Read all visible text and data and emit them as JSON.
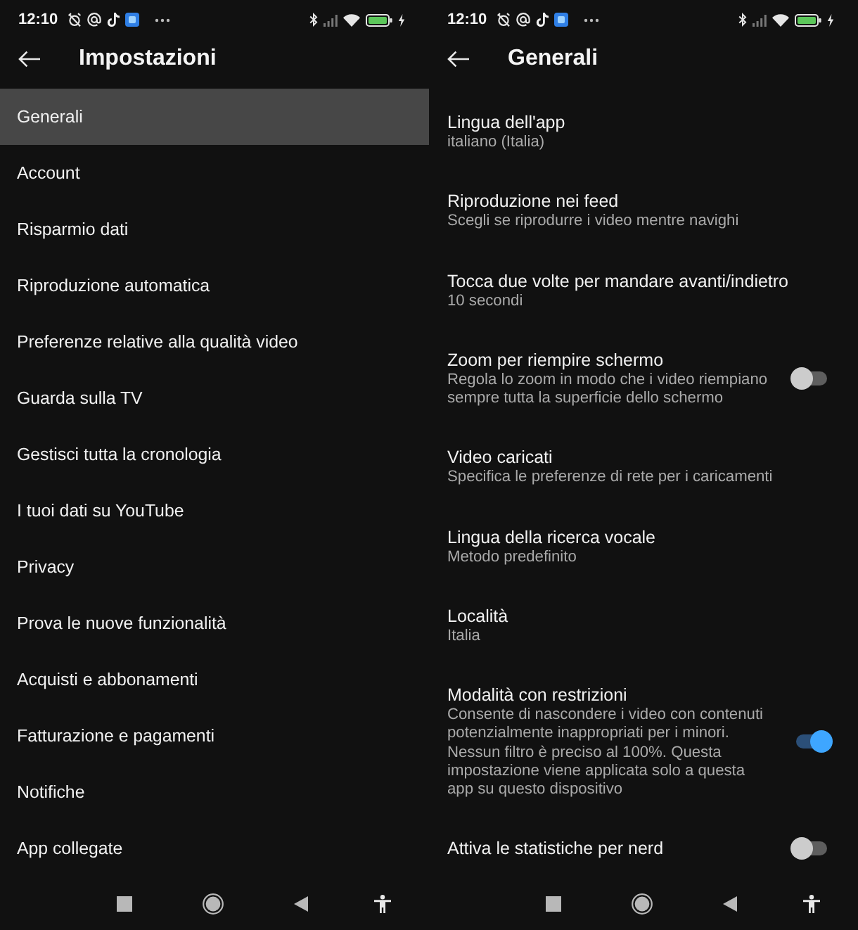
{
  "settings_screen": {
    "status_bar": {
      "time": "12:10"
    },
    "header": {
      "title": "Impostazioni"
    },
    "menu": [
      {
        "label": "Generali",
        "selected": true
      },
      {
        "label": "Account",
        "selected": false
      },
      {
        "label": "Risparmio dati",
        "selected": false
      },
      {
        "label": "Riproduzione automatica",
        "selected": false
      },
      {
        "label": "Preferenze relative alla qualità video",
        "selected": false
      },
      {
        "label": "Guarda sulla TV",
        "selected": false
      },
      {
        "label": "Gestisci tutta la cronologia",
        "selected": false
      },
      {
        "label": "I tuoi dati su YouTube",
        "selected": false
      },
      {
        "label": "Privacy",
        "selected": false
      },
      {
        "label": "Prova le nuove funzionalità",
        "selected": false
      },
      {
        "label": "Acquisti e abbonamenti",
        "selected": false
      },
      {
        "label": "Fatturazione e pagamenti",
        "selected": false
      },
      {
        "label": "Notifiche",
        "selected": false
      },
      {
        "label": "App collegate",
        "selected": false
      }
    ]
  },
  "general_screen": {
    "status_bar": {
      "time": "12:10"
    },
    "header": {
      "title": "Generali"
    },
    "settings": [
      {
        "kind": "option",
        "title": "Lingua dell'app",
        "subtitle": "italiano (Italia)"
      },
      {
        "kind": "option",
        "title": "Riproduzione nei feed",
        "subtitle": "Scegli se riprodurre i video mentre navighi"
      },
      {
        "kind": "option",
        "title": "Tocca due volte per mandare avanti/indietro",
        "subtitle": "10 secondi"
      },
      {
        "kind": "toggle",
        "title": "Zoom per riempire schermo",
        "subtitle": "Regola lo zoom in modo che i video riempiano sempre tutta la superficie dello schermo",
        "on": false
      },
      {
        "kind": "option",
        "title": "Video caricati",
        "subtitle": "Specifica le preferenze di rete per i caricamenti"
      },
      {
        "kind": "option",
        "title": "Lingua della ricerca vocale",
        "subtitle": "Metodo predefinito"
      },
      {
        "kind": "option",
        "title": "Località",
        "subtitle": "Italia"
      },
      {
        "kind": "toggle",
        "title": "Modalità con restrizioni",
        "subtitle": "Consente di nascondere i video con contenuti potenzialmente inappropriati per i minori. Nessun filtro è preciso al 100%. Questa impostazione viene applicata solo a questa app su questo dispositivo",
        "on": true
      },
      {
        "kind": "toggle",
        "title": "Attiva le statistiche per nerd",
        "on": false
      }
    ]
  }
}
